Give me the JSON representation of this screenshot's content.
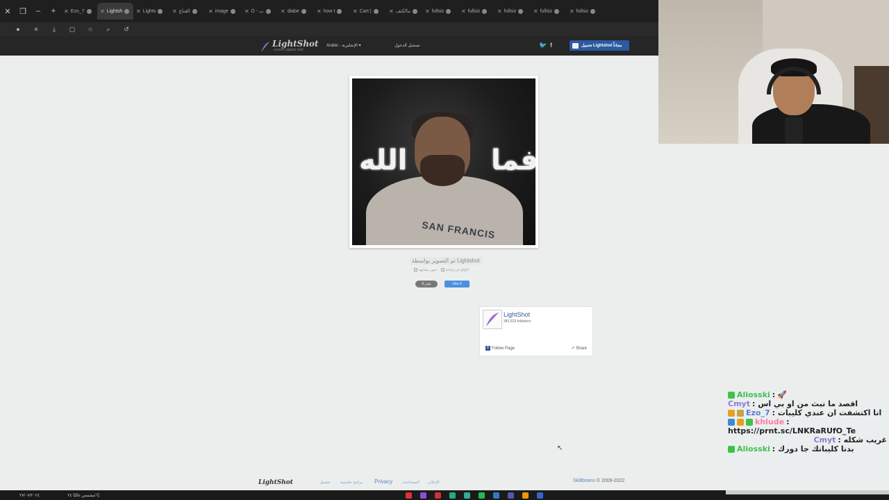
{
  "browser": {
    "tabs": [
      {
        "label": "Ezo_7",
        "active": false
      },
      {
        "label": "Lightsh",
        "active": true
      },
      {
        "label": "Lights",
        "active": false
      },
      {
        "label": "القناع",
        "active": false
      },
      {
        "label": "image",
        "active": false
      },
      {
        "label": "D - ب",
        "active": false
      },
      {
        "label": "diabe",
        "active": false
      },
      {
        "label": "how t",
        "active": false
      },
      {
        "label": "Cart |",
        "active": false
      },
      {
        "label": "مالكتف",
        "active": false
      },
      {
        "label": "fullsiz",
        "active": false
      },
      {
        "label": "fullsiz",
        "active": false
      },
      {
        "label": "fullsiz",
        "active": false
      },
      {
        "label": "fullsiz",
        "active": false
      },
      {
        "label": "fullsiz",
        "active": false
      }
    ]
  },
  "header": {
    "logo_name": "LightShot",
    "logo_tagline": "screen capture tool",
    "language": "Arabic - الإنجليزية",
    "login": "تسجيل الدخول",
    "download_button": "تحميل Lightshot مجاناً"
  },
  "screenshot": {
    "overlay_left": "الله",
    "overlay_right": "فما",
    "hoodie_text": "SAN FRANCIS"
  },
  "meta": {
    "caption": "تم التصوير بواسطة Lightshot",
    "report_abuse": "الإبلاغ عن إساءة",
    "similar": "صور مشابهة",
    "share_x": "X نشر",
    "like": "Like 0"
  },
  "fb": {
    "name": "LightShot",
    "followers": "383,523 followers",
    "follow": "Follow Page",
    "share": "Share"
  },
  "footer": {
    "logo": "LightShot",
    "links": [
      "تحميل",
      "برامج تعليمية",
      "Privacy",
      "المساعدة",
      "الإعلان"
    ],
    "company": "Skillbrains",
    "copyright": "© 2009-2022"
  },
  "taskbar": {
    "clock": "٢٧/٠٧/٢٠٢٤",
    "weather": "مشمس غالبًا ٢٤°C"
  },
  "chat": {
    "messages": [
      {
        "user": "Aliosski",
        "text": ": ",
        "color": "#3ec24a"
      },
      {
        "user": "Cmyt",
        "text": ": اقصد ما تبث من او بي اس",
        "color": "#8a7bd6"
      },
      {
        "user": "Ezo_7",
        "text": ": انا اكتشفت ان عندي كليبات",
        "color": "#5b7ad6"
      },
      {
        "user": "khlude",
        "text": ":",
        "color": "#ff7aa6"
      },
      {
        "user": "Cmyt",
        "text": ": غريب شكله",
        "color": "#8a7bd6"
      },
      {
        "user": "Aliosski",
        "text": ": بدنا كليباتك جا دورك",
        "color": "#3ec24a"
      }
    ],
    "link": "https://prnt.sc/LNKRaRUfO_Te"
  }
}
